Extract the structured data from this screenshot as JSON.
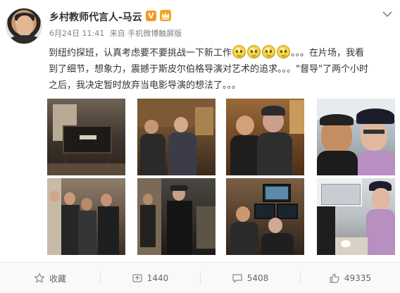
{
  "user": {
    "name": "乡村教师代言人-马云",
    "verified_badge": "V"
  },
  "meta": {
    "date": "6月24日 11:41",
    "source": "来自 手机微博触屏版"
  },
  "post": {
    "line1_a": "到纽约探班，认真考虑要不要挑战一下新工作",
    "line1_b": "。。。在片场，我看",
    "line2": "到了细节，想象力，震撼于斯皮尔伯格导演对艺术的追求。。。\"督导\"了两个小时",
    "line3": "之后，我决定暂时放弃当电影导演的想法了。。。",
    "emoji_count": 4
  },
  "photos": [
    {
      "name": "director-chair-photo"
    },
    {
      "name": "office-group-photo"
    },
    {
      "name": "wood-room-selfie-photo"
    },
    {
      "name": "trailer-selfie-photo"
    },
    {
      "name": "set-crowd-photo"
    },
    {
      "name": "studio-walk-photo"
    },
    {
      "name": "monitor-room-photo"
    },
    {
      "name": "trailer-table-photo"
    }
  ],
  "actions": {
    "favorite_label": "收藏",
    "repost_count": "1440",
    "comment_count": "5408",
    "like_count": "49335"
  },
  "colors": {
    "accent": "#eb7350",
    "vbadge": "#f39a22",
    "text": "#333333",
    "muted": "#808080"
  }
}
